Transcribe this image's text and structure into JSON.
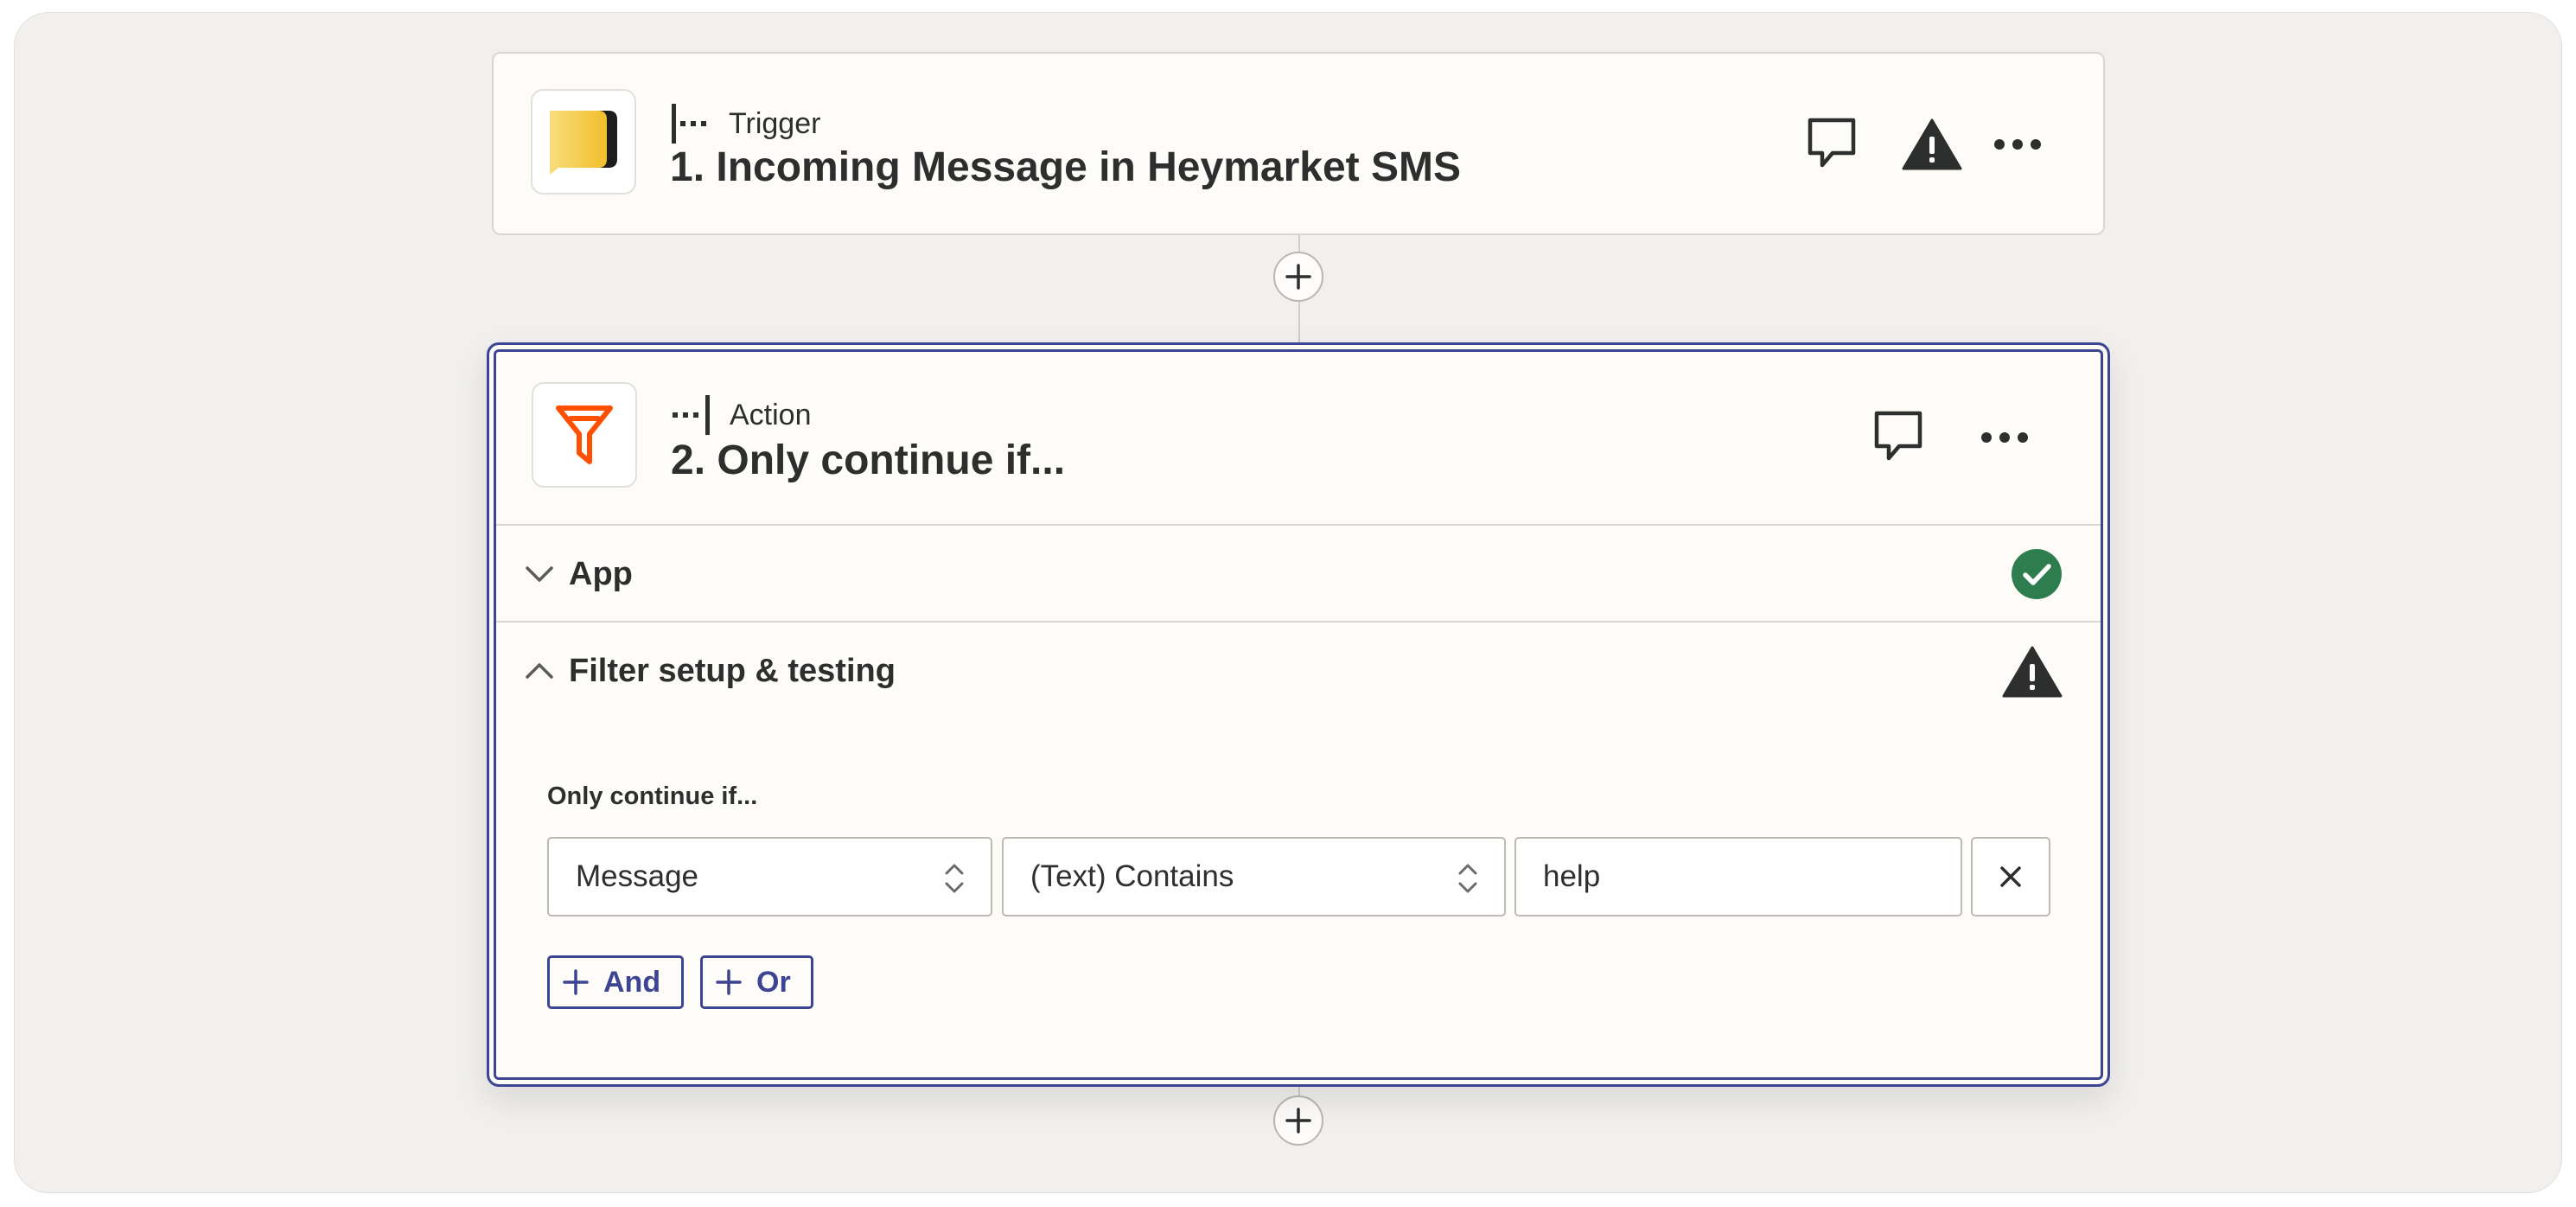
{
  "trigger": {
    "type_label": "Trigger",
    "title": "1. Incoming Message in Heymarket SMS",
    "app_icon": "heymarket-logo",
    "icons": [
      "comment-icon",
      "warning-icon",
      "more-icon"
    ]
  },
  "action": {
    "type_label": "Action",
    "title": "2. Only continue if...",
    "app_icon": "filter-icon",
    "icons": [
      "comment-icon",
      "more-icon"
    ],
    "sections": {
      "app": {
        "label": "App",
        "status": "complete"
      },
      "filter": {
        "label": "Filter setup & testing",
        "status": "warning"
      }
    },
    "filter": {
      "heading": "Only continue if...",
      "field": "Message",
      "condition": "(Text) Contains",
      "value": "help",
      "and_label": "And",
      "or_label": "Or"
    }
  },
  "colors": {
    "accent": "#3d4592",
    "success": "#2e7d4f",
    "filter_orange": "#ff4f00",
    "heymarket_yellow": "#f6cf4a"
  }
}
